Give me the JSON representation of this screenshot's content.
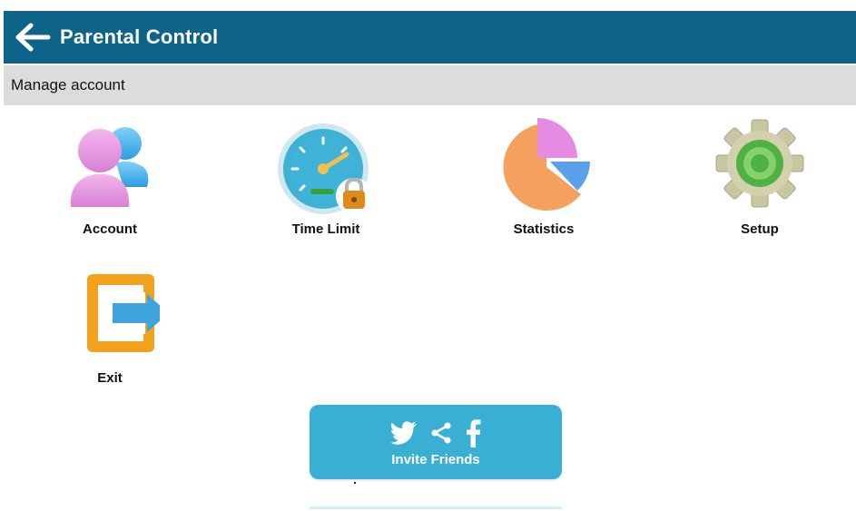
{
  "header": {
    "title": "Parental Control",
    "back_icon": "arrow-left-icon"
  },
  "subheader": {
    "title": "Manage account"
  },
  "menu": [
    {
      "id": "account",
      "label": "Account",
      "icon": "account-icon"
    },
    {
      "id": "time-limit",
      "label": "Time Limit",
      "icon": "timer-lock-icon"
    },
    {
      "id": "statistics",
      "label": "Statistics",
      "icon": "pie-chart-icon"
    },
    {
      "id": "setup",
      "label": "Setup",
      "icon": "gear-icon"
    },
    {
      "id": "exit",
      "label": "Exit",
      "icon": "exit-icon"
    }
  ],
  "invite": {
    "label": "Invite Friends",
    "icons": [
      "twitter-icon",
      "share-icon",
      "facebook-icon"
    ]
  },
  "colors": {
    "appbar": "#0e6389",
    "subbar": "#dcdcdc",
    "invite": "#3aafd4"
  }
}
